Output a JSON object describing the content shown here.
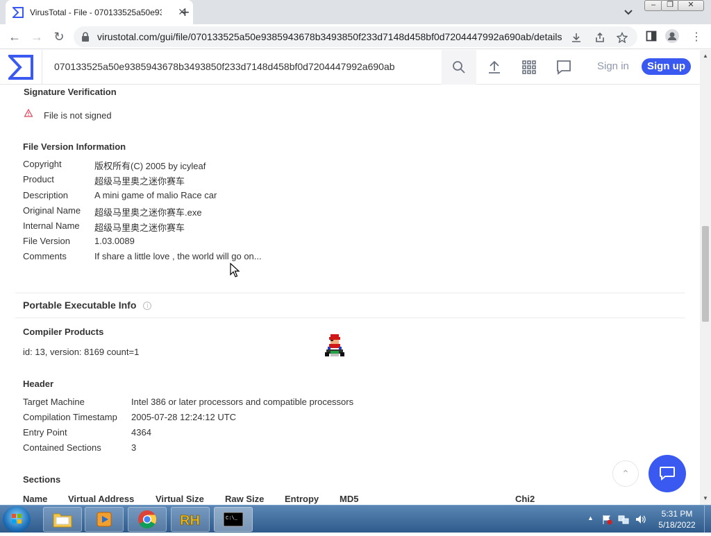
{
  "browser": {
    "tab_title": "VirusTotal - File - 070133525a50e9385943678b3493850f233d7148d458bf0d7204447992a690ab",
    "url": "virustotal.com/gui/file/070133525a50e9385943678b3493850f233d7148d458bf0d7204447992a690ab/details"
  },
  "vt": {
    "search_value": "070133525a50e9385943678b3493850f233d7148d458bf0d7204447992a690ab",
    "sign_in": "Sign in",
    "sign_up": "Sign up",
    "accent": "#3a59f0"
  },
  "signature": {
    "title": "Signature Verification",
    "status": "File is not signed"
  },
  "file_version": {
    "title": "File Version Information",
    "rows": [
      {
        "label": "Copyright",
        "value": "版权所有(C) 2005 by icyleaf"
      },
      {
        "label": "Product",
        "value": "超级马里奥之迷你赛车"
      },
      {
        "label": "Description",
        "value": "A mini game of malio Race car"
      },
      {
        "label": "Original Name",
        "value": "超级马里奥之迷你赛车.exe"
      },
      {
        "label": "Internal Name",
        "value": "超级马里奥之迷你赛车"
      },
      {
        "label": "File Version",
        "value": "1.03.0089"
      },
      {
        "label": "Comments",
        "value": "If share a little love , the world will go on..."
      }
    ]
  },
  "pe": {
    "title": "Portable Executable Info",
    "compiler_title": "Compiler Products",
    "compiler_value": "id: 13, version: 8169 count=1",
    "header_title": "Header",
    "header_rows": [
      {
        "label": "Target Machine",
        "value": "Intel 386 or later processors and compatible processors"
      },
      {
        "label": "Compilation Timestamp",
        "value": "2005-07-28 12:24:12 UTC"
      },
      {
        "label": "Entry Point",
        "value": "4364"
      },
      {
        "label": "Contained Sections",
        "value": "3"
      }
    ],
    "sections_title": "Sections",
    "sections_columns": [
      "Name",
      "Virtual Address",
      "Virtual Size",
      "Raw Size",
      "Entropy",
      "MD5",
      "Chi2"
    ]
  },
  "taskbar": {
    "time": "5:31 PM",
    "date": "5/18/2022"
  }
}
